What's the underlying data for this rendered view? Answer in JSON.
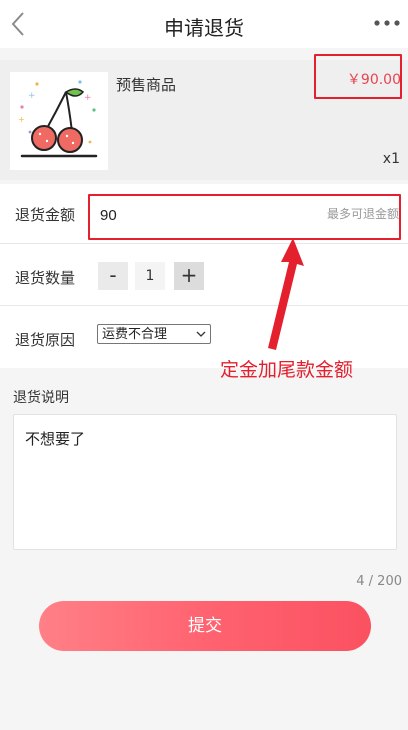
{
  "header": {
    "title": "申请退货"
  },
  "product": {
    "name": "预售商品",
    "price": "￥90.00",
    "quantity": "x1"
  },
  "form": {
    "amount": {
      "label": "退货金额",
      "value": "90",
      "hint": "最多可退金额"
    },
    "quantity": {
      "label": "退货数量",
      "minus": "-",
      "plus": "+",
      "value": "1"
    },
    "reason": {
      "label": "退货原因",
      "selected": "运费不合理"
    },
    "description": {
      "label": "退货说明",
      "value": "不想要了",
      "count": "4 / 200"
    }
  },
  "annotation": {
    "text": "定金加尾款金额",
    "color": "#e4202e"
  },
  "submit": {
    "label": "提交"
  },
  "colors": {
    "accent": "#fb5161",
    "price": "#e64551"
  },
  "icons": {
    "back": "chevron-left-icon",
    "more": "more-dots-icon",
    "select": "chevron-down-icon"
  }
}
